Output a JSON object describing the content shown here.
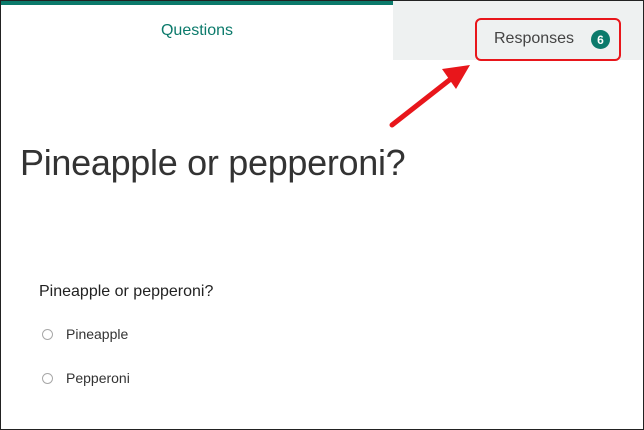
{
  "tabs": {
    "questions_label": "Questions",
    "responses_label": "Responses",
    "responses_count": "6"
  },
  "form": {
    "title": "Pineapple or pepperoni?",
    "question": {
      "text": "Pineapple or pepperoni?",
      "options": [
        {
          "label": "Pineapple"
        },
        {
          "label": "Pepperoni"
        }
      ]
    }
  },
  "colors": {
    "accent": "#0b7a6b",
    "annotation": "#e8161b",
    "inactive_tab_bg": "#eef1f1"
  },
  "icons": {
    "annotation": "red-arrow-icon"
  }
}
